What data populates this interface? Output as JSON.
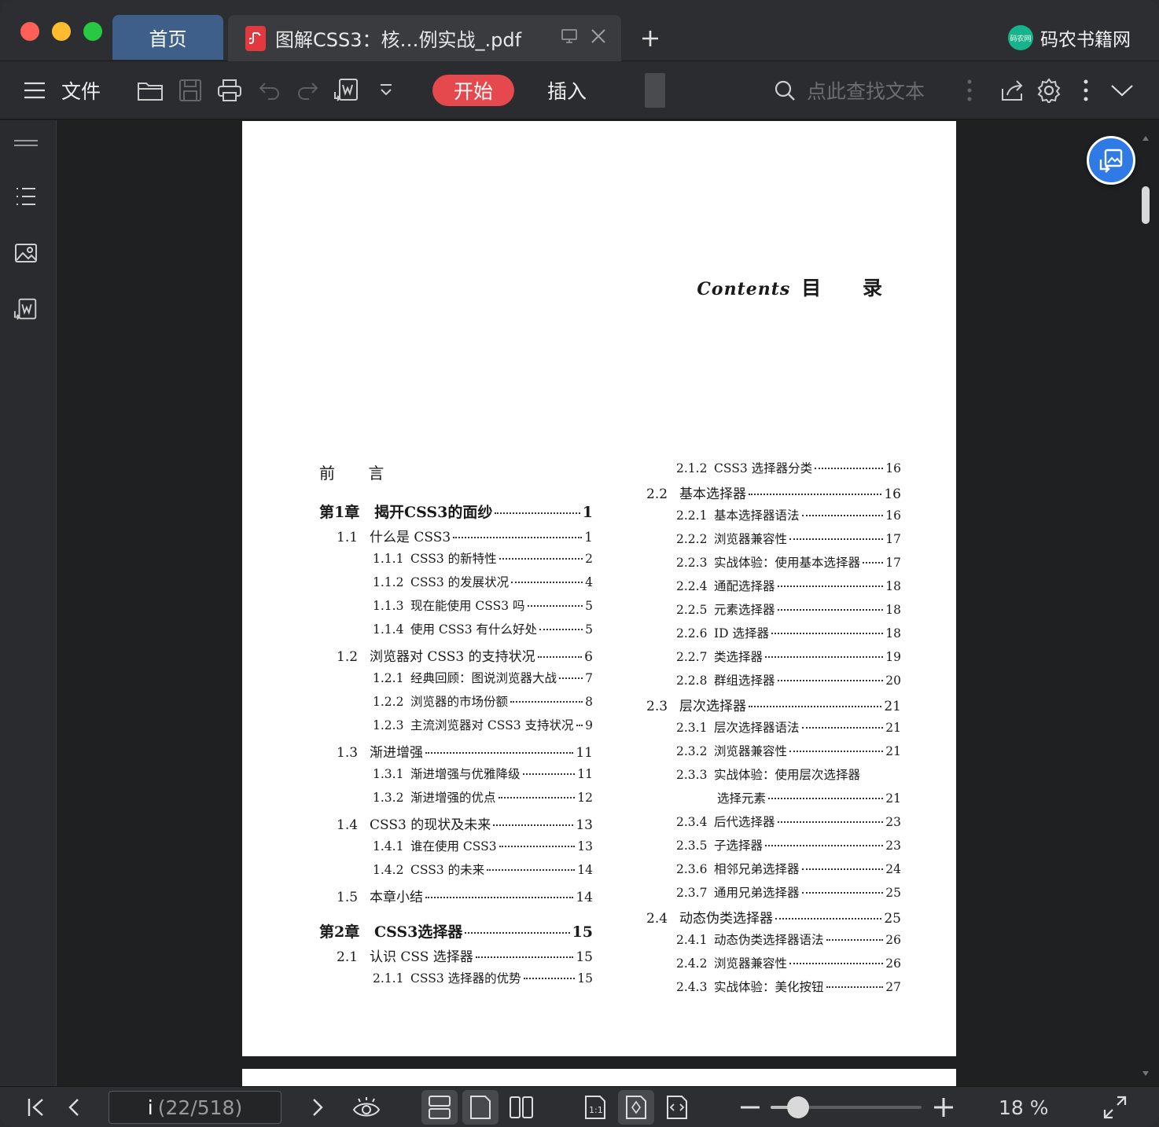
{
  "tabs": {
    "home_label": "首页",
    "doc_title": "图解CSS3：核…例实战_.pdf"
  },
  "brand": {
    "name": "码农书籍网",
    "logo_text": "码农网"
  },
  "toolbar": {
    "file_label": "文件",
    "start_label": "开始",
    "insert_label": "插入",
    "search_placeholder": "点此查找文本"
  },
  "document": {
    "contents_script": "Contents",
    "contents_title": "目 录",
    "preface": "前 言",
    "toc_left": [
      {
        "level": 0,
        "num": "第1章",
        "title": "揭开CSS3的面纱",
        "page": "1"
      },
      {
        "level": 1,
        "num": "1.1",
        "title": "什么是 CSS3",
        "page": "1"
      },
      {
        "level": 2,
        "num": "1.1.1",
        "title": "CSS3 的新特性",
        "page": "2"
      },
      {
        "level": 2,
        "num": "1.1.2",
        "title": "CSS3 的发展状况",
        "page": "4"
      },
      {
        "level": 2,
        "num": "1.1.3",
        "title": "现在能使用 CSS3 吗",
        "page": "5"
      },
      {
        "level": 2,
        "num": "1.1.4",
        "title": "使用 CSS3 有什么好处",
        "page": "5"
      },
      {
        "level": 1,
        "num": "1.2",
        "title": "浏览器对 CSS3 的支持状况",
        "page": "6"
      },
      {
        "level": 2,
        "num": "1.2.1",
        "title": "经典回顾：图说浏览器大战",
        "page": "7"
      },
      {
        "level": 2,
        "num": "1.2.2",
        "title": "浏览器的市场份额",
        "page": "8"
      },
      {
        "level": 2,
        "num": "1.2.3",
        "title": "主流浏览器对 CSS3 支持状况",
        "page": "9"
      },
      {
        "level": 1,
        "num": "1.3",
        "title": "渐进增强",
        "page": "11"
      },
      {
        "level": 2,
        "num": "1.3.1",
        "title": "渐进增强与优雅降级",
        "page": "11"
      },
      {
        "level": 2,
        "num": "1.3.2",
        "title": "渐进增强的优点",
        "page": "12"
      },
      {
        "level": 1,
        "num": "1.4",
        "title": "CSS3 的现状及未来",
        "page": "13"
      },
      {
        "level": 2,
        "num": "1.4.1",
        "title": "谁在使用 CSS3",
        "page": "13"
      },
      {
        "level": 2,
        "num": "1.4.2",
        "title": "CSS3 的未来",
        "page": "14"
      },
      {
        "level": 1,
        "num": "1.5",
        "title": "本章小结",
        "page": "14"
      },
      {
        "level": 0,
        "num": "第2章",
        "title": "CSS3选择器",
        "page": "15"
      },
      {
        "level": 1,
        "num": "2.1",
        "title": "认识 CSS 选择器",
        "page": "15"
      },
      {
        "level": 2,
        "num": "2.1.1",
        "title": "CSS3 选择器的优势",
        "page": "15"
      }
    ],
    "toc_right": [
      {
        "level": 2,
        "num": "2.1.2",
        "title": "CSS3 选择器分类",
        "page": "16"
      },
      {
        "level": 1,
        "num": "2.2",
        "title": "基本选择器",
        "page": "16"
      },
      {
        "level": 2,
        "num": "2.2.1",
        "title": "基本选择器语法",
        "page": "16"
      },
      {
        "level": 2,
        "num": "2.2.2",
        "title": "浏览器兼容性",
        "page": "17"
      },
      {
        "level": 2,
        "num": "2.2.3",
        "title": "实战体验：使用基本选择器",
        "page": "17"
      },
      {
        "level": 2,
        "num": "2.2.4",
        "title": "通配选择器",
        "page": "18"
      },
      {
        "level": 2,
        "num": "2.2.5",
        "title": "元素选择器",
        "page": "18"
      },
      {
        "level": 2,
        "num": "2.2.6",
        "title": "ID 选择器",
        "page": "18"
      },
      {
        "level": 2,
        "num": "2.2.7",
        "title": "类选择器",
        "page": "19"
      },
      {
        "level": 2,
        "num": "2.2.8",
        "title": "群组选择器",
        "page": "20"
      },
      {
        "level": 1,
        "num": "2.3",
        "title": "层次选择器",
        "page": "21"
      },
      {
        "level": 2,
        "num": "2.3.1",
        "title": "层次选择器语法",
        "page": "21"
      },
      {
        "level": 2,
        "num": "2.3.2",
        "title": "浏览器兼容性",
        "page": "21"
      },
      {
        "level": 2,
        "num": "2.3.3",
        "title": "实战体验：使用层次选择器",
        "page": ""
      },
      {
        "level": 3,
        "num": "",
        "title": "选择元素",
        "page": "21"
      },
      {
        "level": 2,
        "num": "2.3.4",
        "title": "后代选择器",
        "page": "23"
      },
      {
        "level": 2,
        "num": "2.3.5",
        "title": "子选择器",
        "page": "23"
      },
      {
        "level": 2,
        "num": "2.3.6",
        "title": "相邻兄弟选择器",
        "page": "24"
      },
      {
        "level": 2,
        "num": "2.3.7",
        "title": "通用兄弟选择器",
        "page": "25"
      },
      {
        "level": 1,
        "num": "2.4",
        "title": "动态伪类选择器",
        "page": "25"
      },
      {
        "level": 2,
        "num": "2.4.1",
        "title": "动态伪类选择器语法",
        "page": "26"
      },
      {
        "level": 2,
        "num": "2.4.2",
        "title": "浏览器兼容性",
        "page": "26"
      },
      {
        "level": 2,
        "num": "2.4.3",
        "title": "实战体验：美化按钮",
        "page": "27"
      }
    ]
  },
  "statusbar": {
    "page_current": "i",
    "page_total": "(22/518)",
    "zoom": "18 %",
    "zoom_fraction": 0.18
  },
  "colors": {
    "accent_red": "#e5484d",
    "accent_blue": "#2f7ae5",
    "home_tab": "#3d5f8a"
  }
}
